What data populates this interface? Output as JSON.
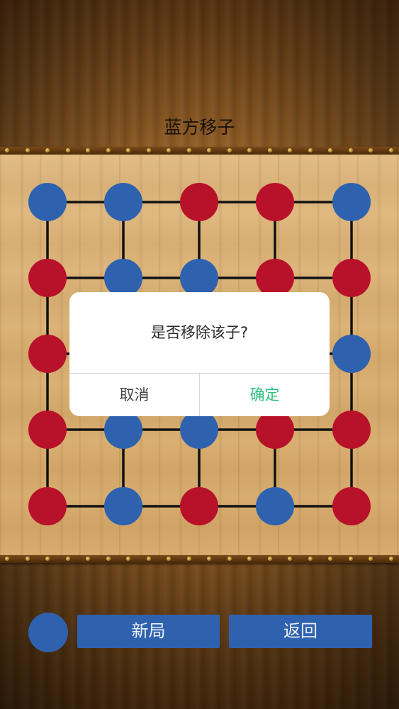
{
  "status": {
    "title": "蓝方移子"
  },
  "colors": {
    "blue": "#2f62ae",
    "red": "#b8112a",
    "line": "#111111"
  },
  "board": {
    "rows": [
      [
        "blue",
        "blue",
        "red",
        "red",
        "blue"
      ],
      [
        "red",
        "blue",
        "blue",
        "red",
        "red"
      ],
      [
        "red",
        "",
        "",
        "",
        "blue"
      ],
      [
        "red",
        "blue",
        "blue",
        "red",
        "red"
      ],
      [
        "red",
        "blue",
        "red",
        "blue",
        "red"
      ]
    ]
  },
  "dialog": {
    "message": "是否移除该子?",
    "cancel_label": "取消",
    "confirm_label": "确定"
  },
  "controls": {
    "turn_indicator_color": "blue",
    "new_game_label": "新局",
    "back_label": "返回"
  }
}
